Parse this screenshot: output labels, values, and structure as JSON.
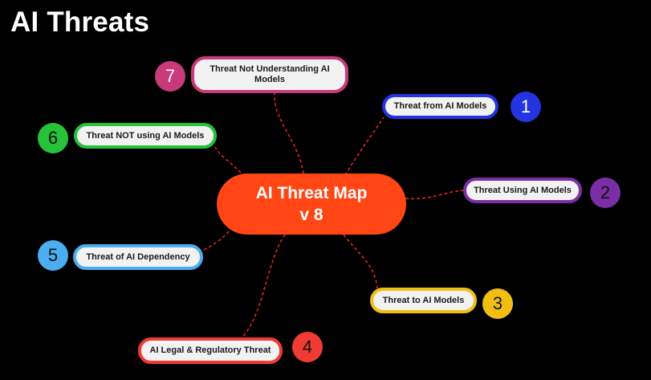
{
  "title": "AI Threats",
  "center": {
    "line1": "AI Threat Map",
    "line2": "v 8",
    "color": "#ff4614"
  },
  "nodes": [
    {
      "num": "1",
      "label": "Threat from AI Models",
      "color": "#2334e0"
    },
    {
      "num": "2",
      "label": "Threat Using AI Models",
      "color": "#7b2fa6"
    },
    {
      "num": "3",
      "label": "Threat to AI Models",
      "color": "#f2be12"
    },
    {
      "num": "4",
      "label": "AI Legal & Regulatory Threat",
      "color": "#ef3b33"
    },
    {
      "num": "5",
      "label": "Threat of AI Dependency",
      "color": "#4aaef0"
    },
    {
      "num": "6",
      "label": "Threat NOT using  AI Models",
      "color": "#26c23a"
    },
    {
      "num": "7",
      "label": "Threat Not Understanding AI Models",
      "color": "#c83a7a"
    }
  ],
  "connector_color": "#e0261b"
}
